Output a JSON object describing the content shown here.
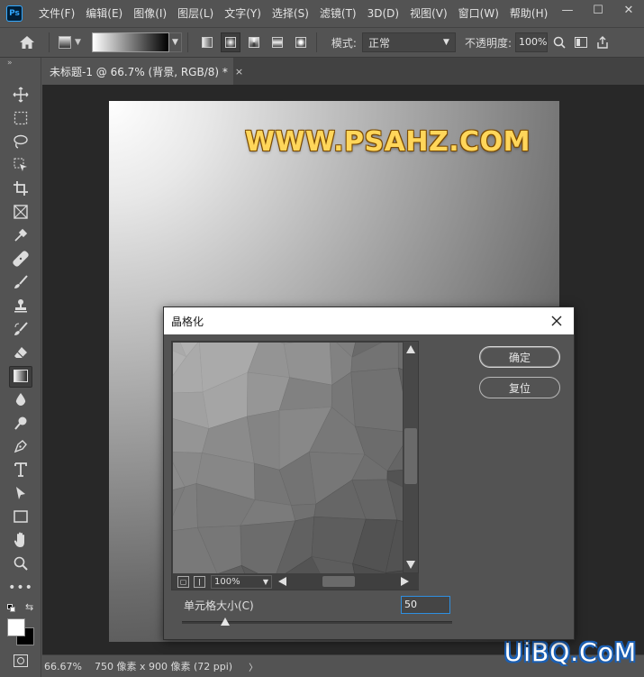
{
  "app": {
    "logo": "Ps"
  },
  "menu": {
    "items": [
      "文件(F)",
      "编辑(E)",
      "图像(I)",
      "图层(L)",
      "文字(Y)",
      "选择(S)",
      "滤镜(T)",
      "3D(D)",
      "视图(V)",
      "窗口(W)",
      "帮助(H)"
    ]
  },
  "window_controls": {
    "minimize": "—",
    "maximize": "☐",
    "close": "✕"
  },
  "options_bar": {
    "mode_label": "模式:",
    "mode_value": "正常",
    "opacity_label": "不透明度:",
    "opacity_value": "100%",
    "gradient_types": [
      "linear",
      "radial",
      "angle",
      "reflected",
      "diamond"
    ],
    "active_gradient_type": "radial"
  },
  "toolbar": {
    "collapse": "»",
    "tools": [
      "move-icon",
      "marquee-icon",
      "lasso-icon",
      "object-select-icon",
      "crop-icon",
      "frame-icon",
      "eyedropper-icon",
      "healing-icon",
      "brush-icon",
      "stamp-icon",
      "history-brush-icon",
      "eraser-icon",
      "gradient-icon",
      "blur-icon",
      "dodge-icon",
      "pen-icon",
      "type-icon",
      "path-select-icon",
      "rectangle-icon",
      "hand-icon",
      "zoom-icon",
      "more-icon"
    ],
    "active_tool": "gradient-icon",
    "foreground_color": "#ffffff",
    "background_color": "#000000"
  },
  "document": {
    "tab_title": "未标题-1 @ 66.7% (背景, RGB/8) *",
    "tab_close": "×",
    "watermark": "WWW.PSAHZ.COM"
  },
  "status_bar": {
    "zoom": "66.67%",
    "info": "750 像素 x 900 像素 (72 ppi)",
    "arrow": "〉"
  },
  "site_watermark": "UiBQ.CoM",
  "dialog": {
    "title": "晶格化",
    "ok_label": "确定",
    "reset_label": "复位",
    "preview_zoom": "100%",
    "cell_size_label": "单元格大小(C)",
    "cell_size_value": "50",
    "cell_size_slider_fraction": 0.16
  },
  "colors": {
    "ui_bg": "#535353",
    "workspace": "#282828",
    "focus_accent": "#2f8fe0",
    "watermark_fill": "#ffd65a",
    "site_mark_outline": "#1a5fb4"
  }
}
